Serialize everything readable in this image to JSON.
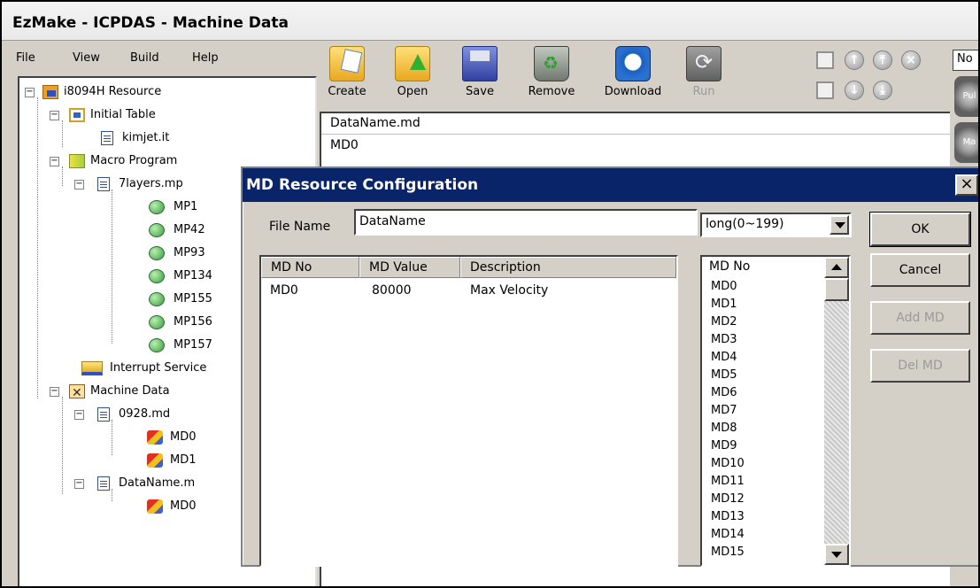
{
  "window": {
    "title": "EzMake - ICPDAS - Machine Data"
  },
  "menu": [
    "File",
    "View",
    "Build",
    "Help"
  ],
  "toolbar": {
    "create": "Create",
    "open": "Open",
    "save": "Save",
    "remove": "Remove",
    "download": "Download",
    "run": "Run",
    "combo_value": "No"
  },
  "tree": {
    "root": "i8094H Resource",
    "initial_table": "Initial Table",
    "kimjet": "kimjet.it",
    "macro_program": "Macro Program",
    "layers": "7layers.mp",
    "mp": [
      "MP1",
      "MP42",
      "MP93",
      "MP134",
      "MP155",
      "MP156",
      "MP157"
    ],
    "interrupt": "Interrupt Service",
    "machine_data": "Machine Data",
    "md0928": "0928.md",
    "md0928_items": [
      "MD0",
      "MD1"
    ],
    "dataname": "DataName.m",
    "dataname_items": [
      "MD0"
    ]
  },
  "editor": {
    "header": "DataName.md",
    "row": "MD0"
  },
  "dialog": {
    "title": "MD Resource Configuration",
    "close": "×",
    "file_name_label": "File Name",
    "file_name_value": "DataName",
    "type_value": "long(0~199)",
    "table": {
      "headers": [
        "MD No",
        "MD Value",
        "Description"
      ],
      "rows": [
        [
          "MD0",
          "80000",
          "Max Velocity"
        ]
      ]
    },
    "list_header": "MD No",
    "list_items": [
      "MD0",
      "MD1",
      "MD2",
      "MD3",
      "MD4",
      "MD5",
      "MD6",
      "MD7",
      "MD8",
      "MD9",
      "MD10",
      "MD11",
      "MD12",
      "MD13",
      "MD14",
      "MD15"
    ],
    "buttons": {
      "ok": "OK",
      "cancel": "Cancel",
      "add": "Add MD",
      "del": "Del MD"
    }
  },
  "side_gears": [
    "Pul",
    "Ma"
  ],
  "colors": {
    "title_bar": "#0a246a",
    "face": "#d4d0c8"
  }
}
